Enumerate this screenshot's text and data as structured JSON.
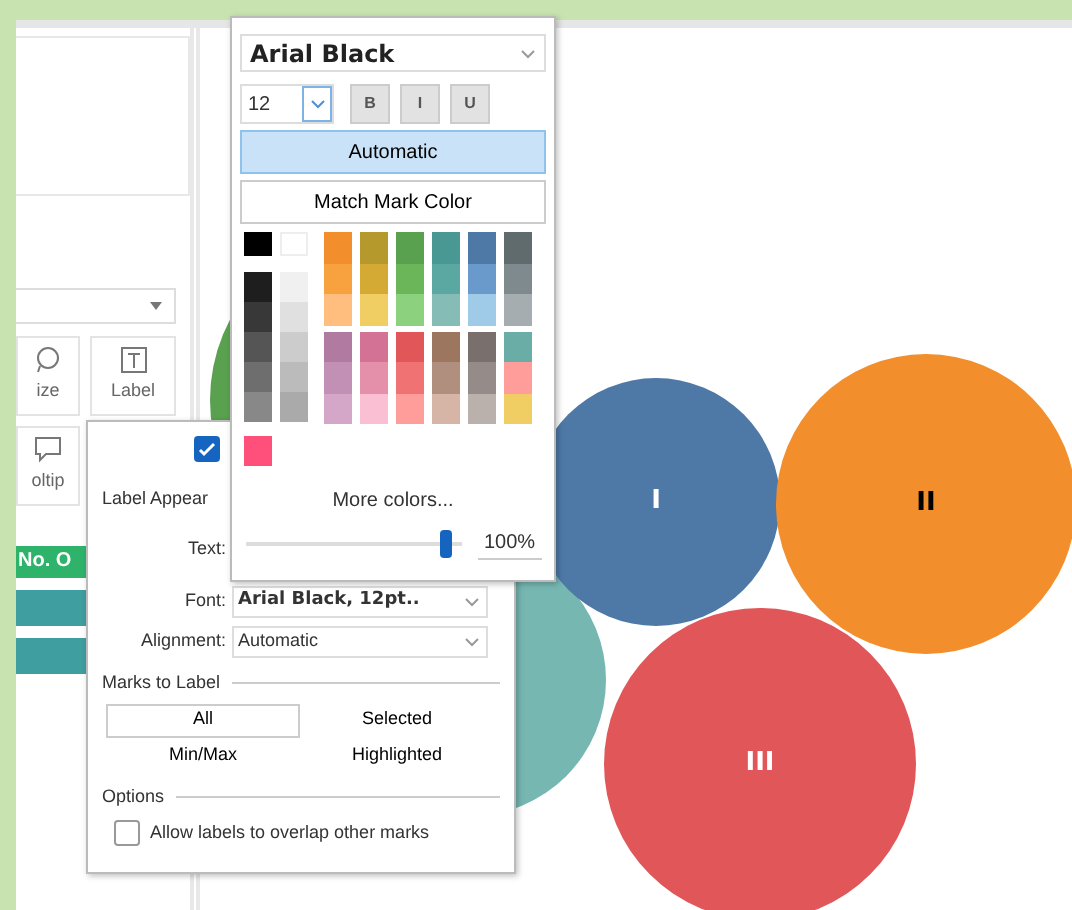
{
  "marks_card": {
    "buttons": [
      {
        "label": "ize",
        "kind": "size"
      },
      {
        "label": "Label",
        "kind": "label"
      },
      {
        "label": "oltip",
        "kind": "tooltip"
      }
    ],
    "pill": "No. O",
    "bars": [
      {
        "color": "#3f9ea0"
      },
      {
        "color": "#3f9ea0"
      }
    ]
  },
  "chart": {
    "bubbles": [
      {
        "color": "#59a14f"
      },
      {
        "color": "#76b7b2"
      },
      {
        "label": "I",
        "color": "#4e79a7"
      },
      {
        "label": "III",
        "color": "#e15759"
      },
      {
        "label": "II",
        "color": "#f28e2b"
      }
    ]
  },
  "label_popup": {
    "show_labels": true,
    "title": "Label Appear",
    "text_label": "Text:",
    "font_label": "Font:",
    "font_value": "Arial Black, 12pt..",
    "alignment_label": "Alignment:",
    "alignment_value": "Automatic",
    "marks_section": "Marks to Label",
    "marks_options": [
      {
        "label": "All",
        "selected": true
      },
      {
        "label": "Selected",
        "selected": false
      },
      {
        "label": "Min/Max",
        "selected": false
      },
      {
        "label": "Highlighted",
        "selected": false
      }
    ],
    "options_section": "Options",
    "overlap": {
      "label": "Allow labels to overlap other marks",
      "checked": false
    }
  },
  "font_popup": {
    "font": "Arial Black",
    "size": "12",
    "styles": [
      "B",
      "I",
      "U"
    ],
    "choices": [
      {
        "label": "Automatic",
        "selected": true
      },
      {
        "label": "Match Mark Color",
        "selected": false
      }
    ],
    "basic": [
      {
        "color": "#000000"
      },
      {
        "color": "#ffffff"
      }
    ],
    "gray_columns": [
      [
        {
          "color": "#1e1e1e"
        },
        {
          "color": "#383838"
        },
        {
          "color": "#555555"
        },
        {
          "color": "#6e6e6e"
        },
        {
          "color": "#888888"
        }
      ],
      [
        {
          "color": "#f0f0f0"
        },
        {
          "color": "#e0e0e0"
        },
        {
          "color": "#cccccc"
        },
        {
          "color": "#bbbbbb"
        },
        {
          "color": "#aaaaaa"
        }
      ]
    ],
    "color_columns": [
      [
        {
          "color": "#f28e2b"
        },
        {
          "color": "#f7a13f"
        },
        {
          "color": "#ffbe7d"
        },
        {
          "color": "#b07aa1"
        },
        {
          "color": "#c28fb5"
        },
        {
          "color": "#d4a6c8"
        }
      ],
      [
        {
          "color": "#b6992d"
        },
        {
          "color": "#d4a934"
        },
        {
          "color": "#f1ce63"
        },
        {
          "color": "#d37295"
        },
        {
          "color": "#e590ab"
        },
        {
          "color": "#fabfd2"
        }
      ],
      [
        {
          "color": "#59a14f"
        },
        {
          "color": "#6ab659"
        },
        {
          "color": "#8cd17d"
        },
        {
          "color": "#e15759"
        },
        {
          "color": "#f07272"
        },
        {
          "color": "#ff9d9a"
        }
      ],
      [
        {
          "color": "#499894"
        },
        {
          "color": "#5ba8a3"
        },
        {
          "color": "#86bcb6"
        },
        {
          "color": "#9d7660"
        },
        {
          "color": "#b08f7f"
        },
        {
          "color": "#d7b5a6"
        }
      ],
      [
        {
          "color": "#4e79a7"
        },
        {
          "color": "#6a9acb"
        },
        {
          "color": "#a0cbe8"
        },
        {
          "color": "#79706e"
        },
        {
          "color": "#958b88"
        },
        {
          "color": "#bab0ac"
        }
      ],
      [
        {
          "color": "#5f6b6d"
        },
        {
          "color": "#7f8a8e"
        },
        {
          "color": "#a6adb0"
        },
        {
          "color": "#6aada6"
        },
        {
          "color": "#ff9d9a"
        },
        {
          "color": "#f1ce63"
        }
      ]
    ],
    "custom": [
      {
        "color": "#ff4f7b"
      }
    ],
    "more": "More colors...",
    "opacity": {
      "level": 0.95,
      "reading": "100%"
    }
  }
}
